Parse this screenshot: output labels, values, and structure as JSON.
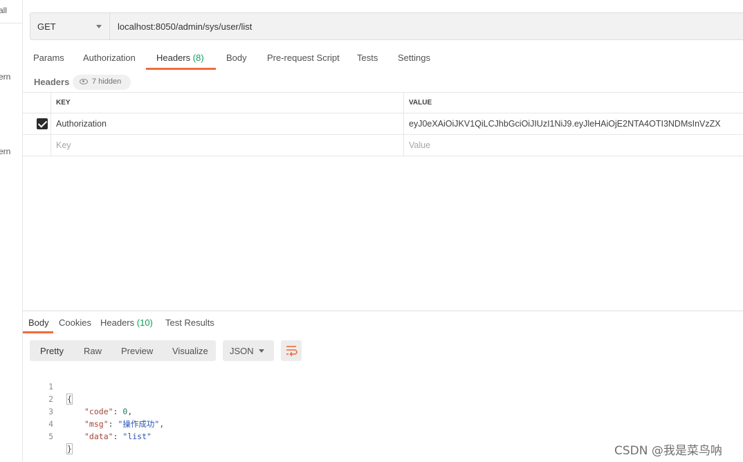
{
  "sidebar": {
    "texts": [
      "all",
      "ern",
      "ern"
    ]
  },
  "request": {
    "method": "GET",
    "url": "localhost:8050/admin/sys/user/list"
  },
  "request_tabs": {
    "params": "Params",
    "authorization": "Authorization",
    "headers": "Headers",
    "headers_count": "(8)",
    "body": "Body",
    "prerequest": "Pre-request Script",
    "tests": "Tests",
    "settings": "Settings",
    "active": "Headers"
  },
  "headers_section": {
    "label": "Headers",
    "hidden_label": "7 hidden"
  },
  "headers_table": {
    "col_key": "KEY",
    "col_value": "VALUE",
    "rows": [
      {
        "enabled": true,
        "key": "Authorization",
        "value": "eyJ0eXAiOiJKV1QiLCJhbGciOiJIUzI1NiJ9.eyJleHAiOjE2NTA4OTI3NDMsInVzZX"
      }
    ],
    "placeholder_key": "Key",
    "placeholder_value": "Value"
  },
  "response_tabs": {
    "body": "Body",
    "cookies": "Cookies",
    "headers": "Headers",
    "headers_count": "(10)",
    "test_results": "Test Results",
    "active": "Body"
  },
  "response_toolbar": {
    "pretty": "Pretty",
    "raw": "Raw",
    "preview": "Preview",
    "visualize": "Visualize",
    "language": "JSON",
    "wrap_icon": "wrap-lines-icon"
  },
  "response_body": {
    "lines": [
      "1",
      "2",
      "3",
      "4",
      "5"
    ],
    "open": "{",
    "close": "}",
    "code_key": "\"code\"",
    "code_value": "0",
    "msg_key": "\"msg\"",
    "msg_value": "\"操作成功\"",
    "data_key": "\"data\"",
    "data_value": "\"list\""
  },
  "watermark": "CSDN @我是菜鸟呐",
  "colors": {
    "accent": "#f26b3a",
    "count": "#0f9d58"
  }
}
